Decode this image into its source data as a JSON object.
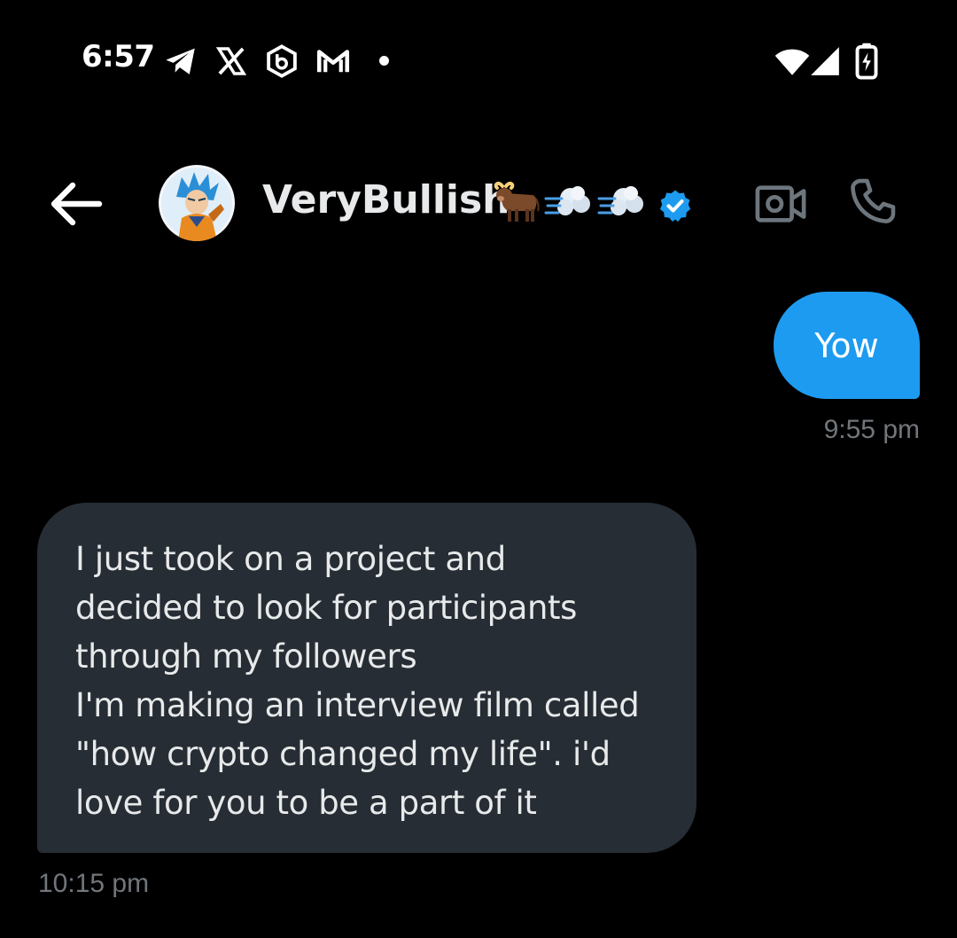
{
  "status_bar": {
    "time": "6:57",
    "left_icons": [
      "telegram-icon",
      "x-icon",
      "bybit-icon",
      "gmail-icon",
      "notification-dot"
    ],
    "right_icons": [
      "wifi-icon",
      "signal-icon",
      "battery-charging-icon"
    ]
  },
  "header": {
    "back_icon": "arrow-left-icon",
    "contact_name": "VeryBullish",
    "name_emojis": [
      "ox-emoji",
      "dash-emoji",
      "dash-emoji"
    ],
    "verified": true,
    "actions": [
      "video-call-icon",
      "phone-icon"
    ]
  },
  "conversation": {
    "messages": [
      {
        "direction": "sent",
        "text": "Yow",
        "time": "9:55 pm"
      },
      {
        "direction": "received",
        "text": "I just took on a project and\ndecided to look for participants\nthrough my followers\nI'm making an interview film called\n\"how crypto changed my life\". i'd\nlove for you to be a part of it",
        "time": "10:15 pm"
      }
    ]
  },
  "colors": {
    "background": "#000000",
    "sent_bubble": "#1d9bf0",
    "received_bubble": "#262d34",
    "timestamp": "#71767b",
    "text": "#e7e9ea",
    "verified_badge": "#1d9bf0"
  }
}
